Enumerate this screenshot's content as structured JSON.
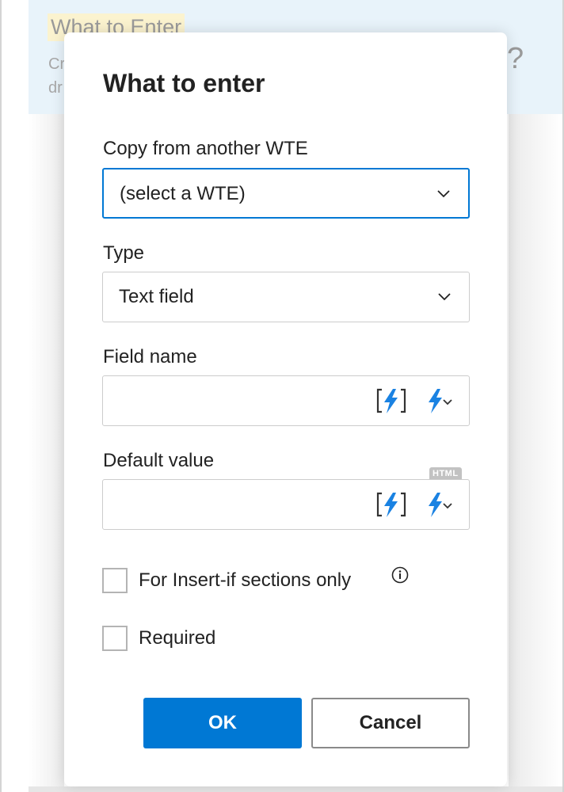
{
  "background": {
    "section_title": "What to Enter",
    "description_lines": [
      "Cr",
      "dr"
    ],
    "help_glyph": "?"
  },
  "dialog": {
    "title": "What to enter",
    "copy_from": {
      "label": "Copy from another WTE",
      "selected": "(select a WTE)",
      "icon": "chevron-down-icon"
    },
    "type": {
      "label": "Type",
      "selected": "Text field",
      "icon": "chevron-down-icon"
    },
    "field_name": {
      "label": "Field name",
      "value": "",
      "placeholder": "",
      "insert_field_icon": "bracketed-flash-icon",
      "flash_menu_icon": "flash-dropdown-icon"
    },
    "default_value": {
      "label": "Default value",
      "badge": "HTML",
      "value": "",
      "placeholder": "",
      "insert_field_icon": "bracketed-flash-icon",
      "flash_menu_icon": "flash-dropdown-icon"
    },
    "checkboxes": [
      {
        "label": "For Insert-if sections only",
        "checked": false,
        "has_info": true,
        "info_icon": "info-icon"
      },
      {
        "label": "Required",
        "checked": false,
        "has_info": false
      }
    ],
    "buttons": {
      "ok": "OK",
      "cancel": "Cancel"
    }
  },
  "colors": {
    "accent": "#0078d4",
    "flash": "#1a82e2",
    "panel_bg": "#e8f3fa",
    "highlight": "#fbf3cf"
  }
}
